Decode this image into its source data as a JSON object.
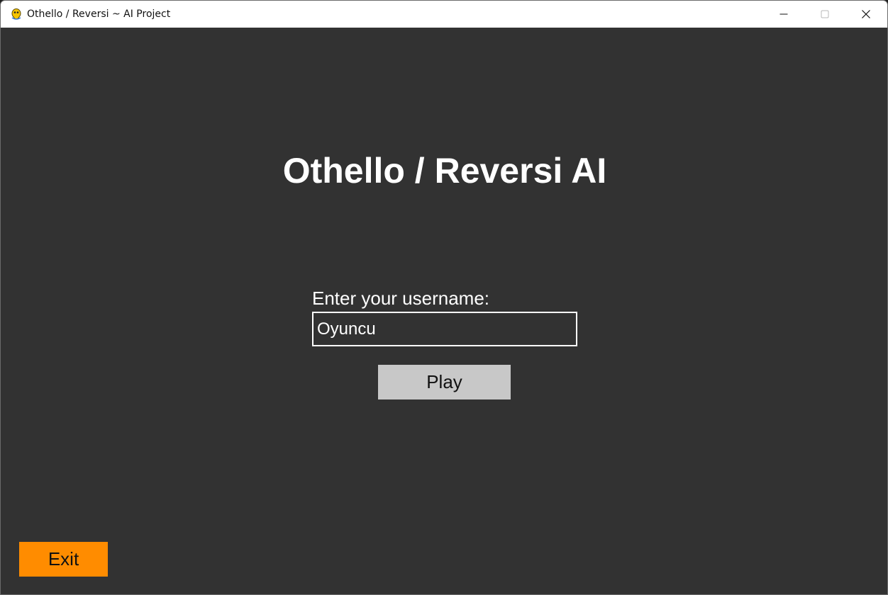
{
  "window": {
    "title": "Othello / Reversi ~ AI Project",
    "icon": "pygame-snake-icon"
  },
  "main": {
    "heading": "Othello / Reversi AI",
    "username_label": "Enter your username:",
    "username_value": "Oyuncu",
    "play_label": "Play",
    "exit_label": "Exit"
  },
  "colors": {
    "background": "#323232",
    "play_button": "#c8c8c8",
    "exit_button": "#ff8c00",
    "text": "#ffffff"
  }
}
